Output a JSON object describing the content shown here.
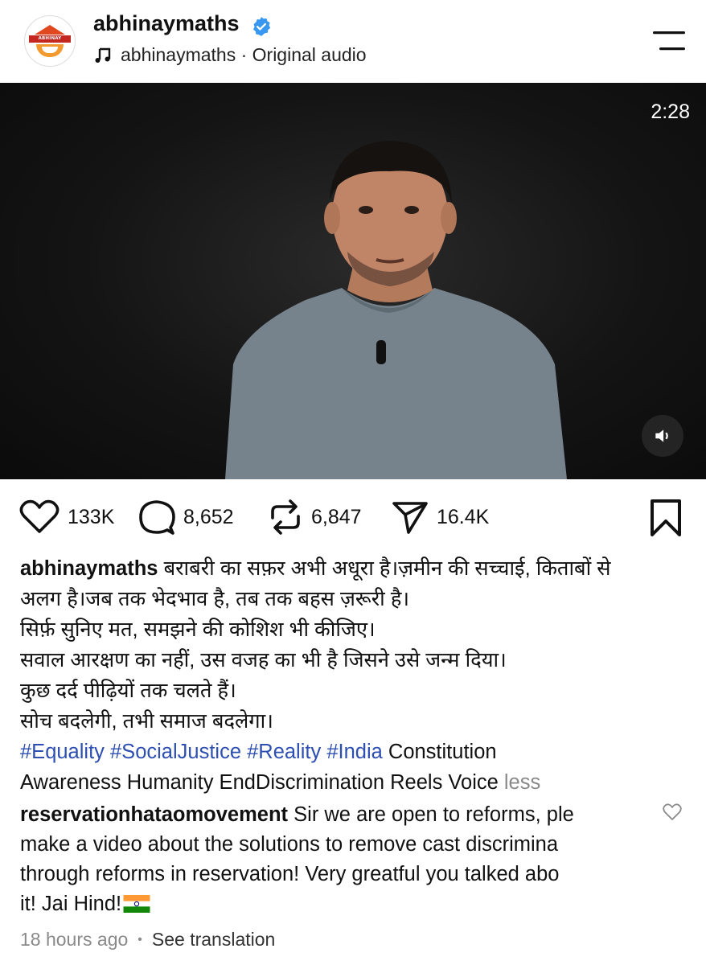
{
  "header": {
    "username": "abhinaymaths",
    "avatar_text": "ABHINAY MATHS",
    "audio": "abhinaymaths · Original audio",
    "verified_icon": "verified-badge-icon",
    "menu_icon": "menu-icon"
  },
  "video": {
    "duration": "2:28",
    "mute_icon": "volume-icon"
  },
  "actions": {
    "likes": "133K",
    "comments": "8,652",
    "reposts": "6,847",
    "shares": "16.4K"
  },
  "caption": {
    "username": "abhinaymaths",
    "lines": [
      "बराबरी का सफ़र अभी अधूरा है।ज़मीन की सच्चाई, किताबों से",
      "अलग है।जब तक भेदभाव है, तब तक बहस ज़रूरी है।",
      "सिर्फ़ सुनिए मत, समझने की कोशिश भी कीजिए।",
      "सवाल आरक्षण का नहीं, उस वजह का भी है जिसने उसे जन्म दिया।",
      "कुछ दर्द पीढ़ियों तक चलते हैं।",
      "सोच बदलेगी, तभी समाज बदलेगा।"
    ],
    "hashtags": [
      "#Equality",
      "#SocialJustice",
      "#Reality",
      "#India"
    ],
    "tail_1": "Constitution",
    "tail_2": "Awareness Humanity EndDiscrimination Reels Voice",
    "less": "less"
  },
  "comment": {
    "username": "reservationhataomovement",
    "line1": "Sir we are open to reforms, ple",
    "line2": "make a video about the solutions to remove cast discrimina",
    "line3": "through reforms in reservation! Very greatful you talked abo",
    "line4": "it! Jai Hind!",
    "time": "18 hours ago",
    "translate": "See translation"
  },
  "colors": {
    "hashtag": "#2d4fb2",
    "verified": "#3897f0",
    "muted": "#8a8a8a"
  }
}
